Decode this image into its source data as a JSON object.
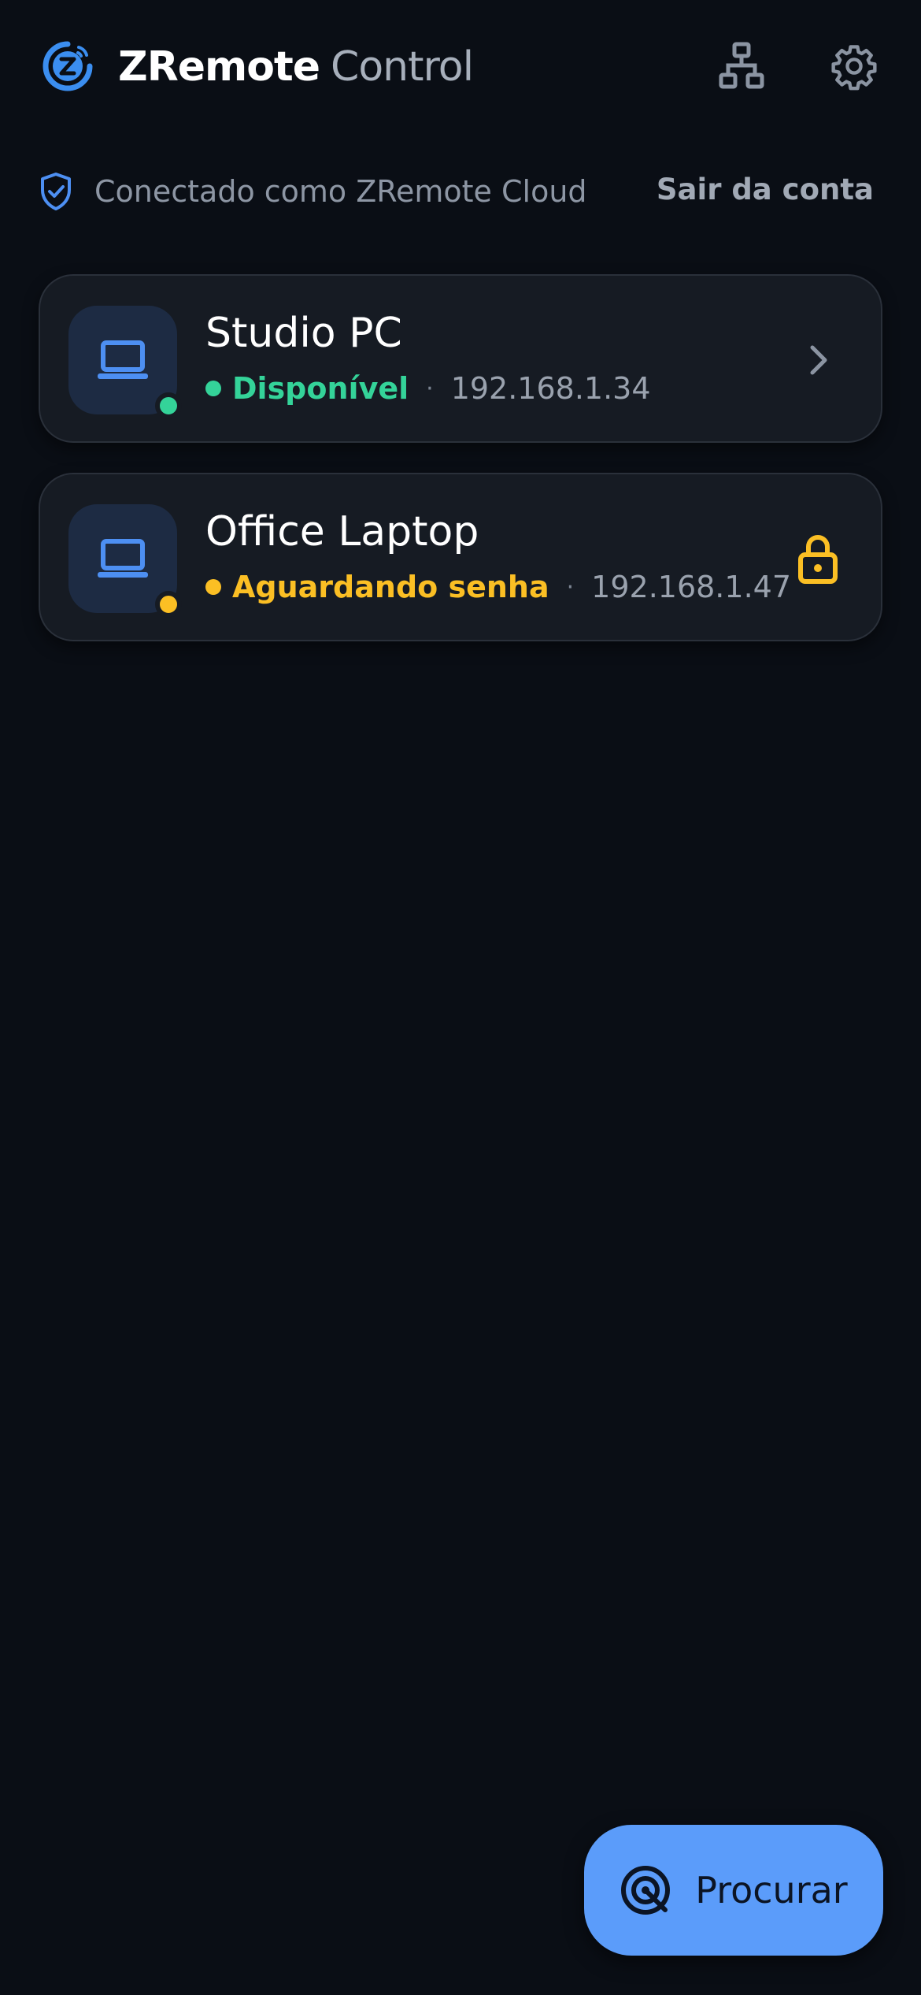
{
  "colors": {
    "background": "#0a0e15",
    "card": "#161b23",
    "accent": "#5b9cfa",
    "available": "#34d399",
    "waiting": "#fbbf24",
    "muted": "#8d96a4"
  },
  "header": {
    "brand_strong": "ZRemote",
    "brand_light": "Control",
    "logo_icon": "zremote-logo-icon",
    "network_icon": "network-tree-icon",
    "settings_icon": "gear-icon"
  },
  "account": {
    "icon": "shield-check-icon",
    "status": "Conectado como ZRemote Cloud",
    "signout": "Sair da conta"
  },
  "devices": [
    {
      "name": "Studio PC",
      "status": "Disponível",
      "status_color": "#34d399",
      "separator": "·",
      "ip": "192.168.1.34",
      "icon": "laptop-icon",
      "trailing_icon": "chevron-right-icon"
    },
    {
      "name": "Office Laptop",
      "status": "Aguardando senha",
      "status_color": "#fbbf24",
      "separator": "·",
      "ip": "192.168.1.47",
      "icon": "laptop-icon",
      "trailing_icon": "lock-icon"
    }
  ],
  "fab": {
    "label": "Procurar",
    "icon": "radar-search-icon"
  }
}
